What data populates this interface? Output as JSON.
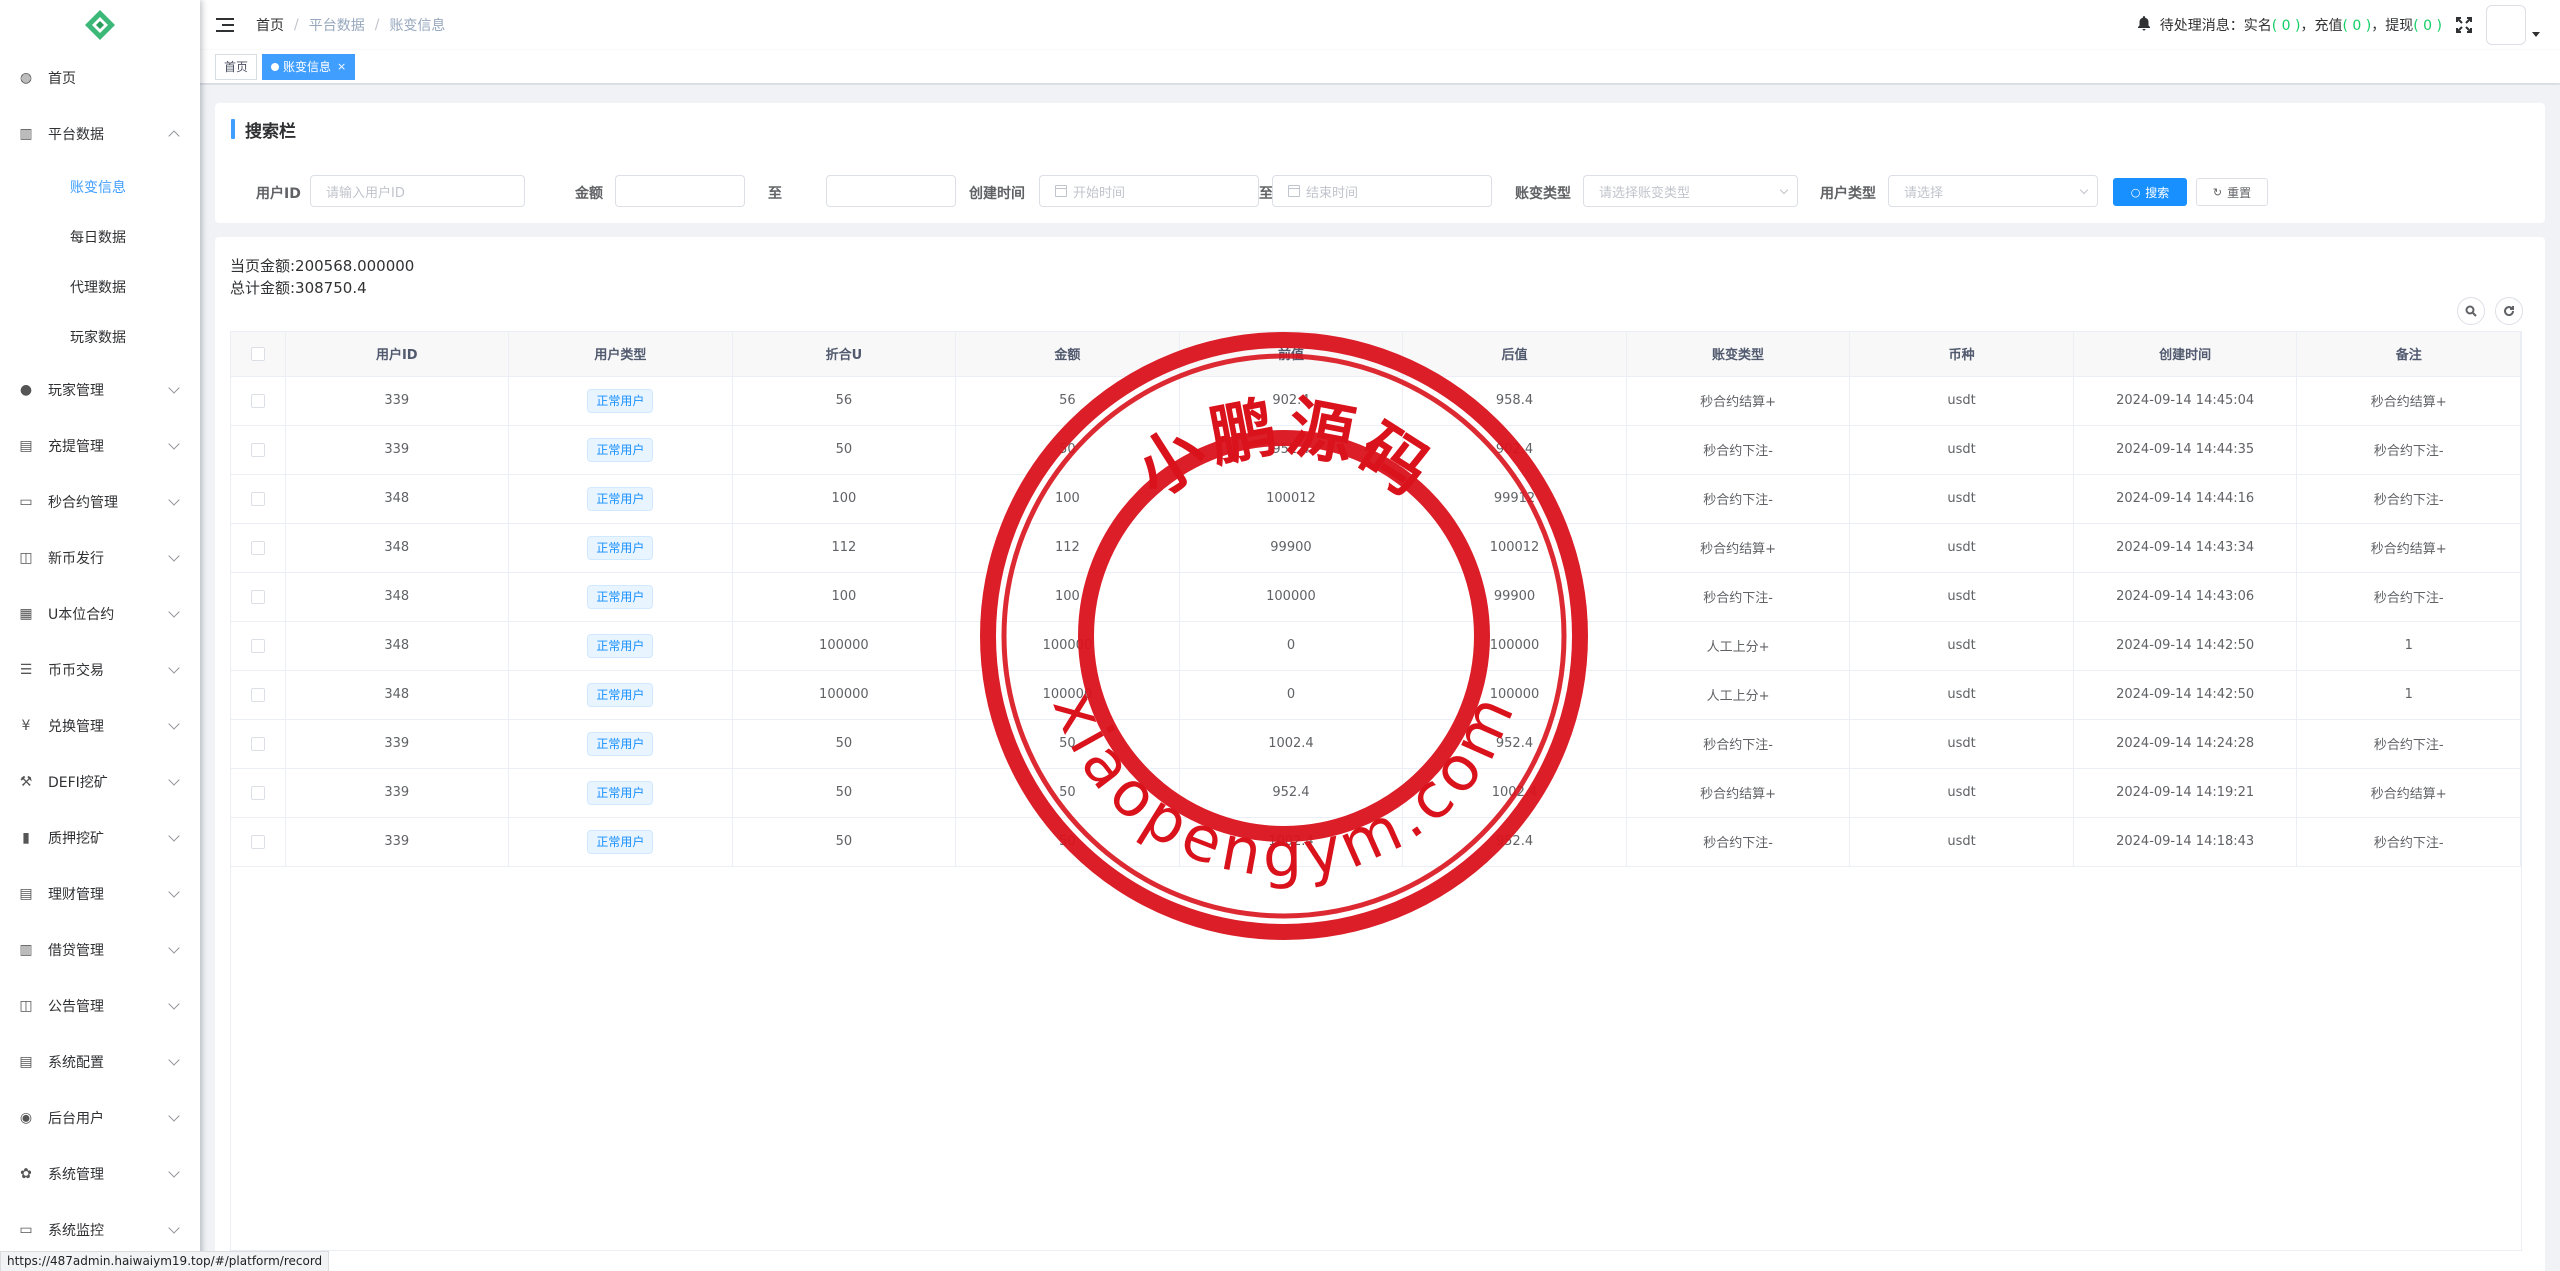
{
  "sidebar": {
    "items": [
      {
        "label": "首页",
        "icon": "dashboard-icon",
        "expandable": false
      },
      {
        "label": "平台数据",
        "icon": "platform-icon",
        "expandable": true,
        "expanded": true,
        "children": [
          {
            "label": "账变信息",
            "active": true
          },
          {
            "label": "每日数据",
            "active": false
          },
          {
            "label": "代理数据",
            "active": false
          },
          {
            "label": "玩家数据",
            "active": false
          }
        ]
      },
      {
        "label": "玩家管理",
        "icon": "user-icon",
        "expandable": true
      },
      {
        "label": "充提管理",
        "icon": "deposit-icon",
        "expandable": true
      },
      {
        "label": "秒合约管理",
        "icon": "monitor-icon",
        "expandable": true
      },
      {
        "label": "新币发行",
        "icon": "coin-icon",
        "expandable": true
      },
      {
        "label": "U本位合约",
        "icon": "grid-icon",
        "expandable": true
      },
      {
        "label": "币币交易",
        "icon": "list-icon",
        "expandable": true
      },
      {
        "label": "兑换管理",
        "icon": "yen-icon",
        "expandable": true
      },
      {
        "label": "DEFI挖矿",
        "icon": "miner-icon",
        "expandable": true
      },
      {
        "label": "质押挖矿",
        "icon": "bar-chart-icon",
        "expandable": true
      },
      {
        "label": "理财管理",
        "icon": "document-icon",
        "expandable": true
      },
      {
        "label": "借贷管理",
        "icon": "book-icon",
        "expandable": true
      },
      {
        "label": "公告管理",
        "icon": "open-book-icon",
        "expandable": true
      },
      {
        "label": "系统配置",
        "icon": "config-icon",
        "expandable": true
      },
      {
        "label": "后台用户",
        "icon": "admin-user-icon",
        "expandable": true
      },
      {
        "label": "系统管理",
        "icon": "gear-icon",
        "expandable": true
      },
      {
        "label": "系统监控",
        "icon": "monitor-icon",
        "expandable": true
      }
    ]
  },
  "header": {
    "breadcrumb": [
      "首页",
      "平台数据",
      "账变信息"
    ],
    "notice_prefix": "待处理消息：",
    "notice_items": [
      {
        "label": "实名",
        "count": "0"
      },
      {
        "label": "充值",
        "count": "0"
      },
      {
        "label": "提现",
        "count": "0"
      }
    ]
  },
  "tags": [
    {
      "label": "首页",
      "active": false
    },
    {
      "label": "账变信息",
      "active": true
    }
  ],
  "search": {
    "title": "搜索栏",
    "user_id_label": "用户ID",
    "user_id_placeholder": "请输入用户ID",
    "amount_label": "金额",
    "to_label": "至",
    "created_label": "创建时间",
    "start_placeholder": "开始时间",
    "end_placeholder": "结束时间",
    "change_type_label": "账变类型",
    "change_type_placeholder": "请选择账变类型",
    "user_type_label": "用户类型",
    "user_type_placeholder": "请选择",
    "search_btn": "搜索",
    "reset_btn": "重置"
  },
  "summary": {
    "page_amount": "当页金额:200568.000000",
    "total_amount": "总计金额:308750.4"
  },
  "table": {
    "columns": [
      "用户ID",
      "用户类型",
      "折合U",
      "金额",
      "前值",
      "后值",
      "账变类型",
      "币种",
      "创建时间",
      "备注"
    ],
    "rows": [
      [
        "339",
        "正常用户",
        "56",
        "56",
        "902.4",
        "958.4",
        "秒合约结算+",
        "usdt",
        "2024-09-14 14:45:04",
        "秒合约结算+"
      ],
      [
        "339",
        "正常用户",
        "50",
        "50",
        "952.4",
        "902.4",
        "秒合约下注-",
        "usdt",
        "2024-09-14 14:44:35",
        "秒合约下注-"
      ],
      [
        "348",
        "正常用户",
        "100",
        "100",
        "100012",
        "99912",
        "秒合约下注-",
        "usdt",
        "2024-09-14 14:44:16",
        "秒合约下注-"
      ],
      [
        "348",
        "正常用户",
        "112",
        "112",
        "99900",
        "100012",
        "秒合约结算+",
        "usdt",
        "2024-09-14 14:43:34",
        "秒合约结算+"
      ],
      [
        "348",
        "正常用户",
        "100",
        "100",
        "100000",
        "99900",
        "秒合约下注-",
        "usdt",
        "2024-09-14 14:43:06",
        "秒合约下注-"
      ],
      [
        "348",
        "正常用户",
        "100000",
        "100000",
        "0",
        "100000",
        "人工上分+",
        "usdt",
        "2024-09-14 14:42:50",
        "1"
      ],
      [
        "348",
        "正常用户",
        "100000",
        "100000",
        "0",
        "100000",
        "人工上分+",
        "usdt",
        "2024-09-14 14:42:50",
        "1"
      ],
      [
        "339",
        "正常用户",
        "50",
        "50",
        "1002.4",
        "952.4",
        "秒合约下注-",
        "usdt",
        "2024-09-14 14:24:28",
        "秒合约下注-"
      ],
      [
        "339",
        "正常用户",
        "50",
        "50",
        "952.4",
        "1002.4",
        "秒合约结算+",
        "usdt",
        "2024-09-14 14:19:21",
        "秒合约结算+"
      ],
      [
        "339",
        "正常用户",
        "50",
        "50",
        "1002.4",
        "952.4",
        "秒合约下注-",
        "usdt",
        "2024-09-14 14:18:43",
        "秒合约下注-"
      ]
    ]
  },
  "watermark": {
    "top_text": "小鹏源码",
    "bottom_text": "xiaopengym.com",
    "color": "#d9121c"
  },
  "statusbar": {
    "url": "https://487admin.haiwaiym19.top/#/platform/record"
  },
  "colors": {
    "accent": "#1890ff",
    "active_menu": "#409eff",
    "notice_count": "#13ce66"
  }
}
